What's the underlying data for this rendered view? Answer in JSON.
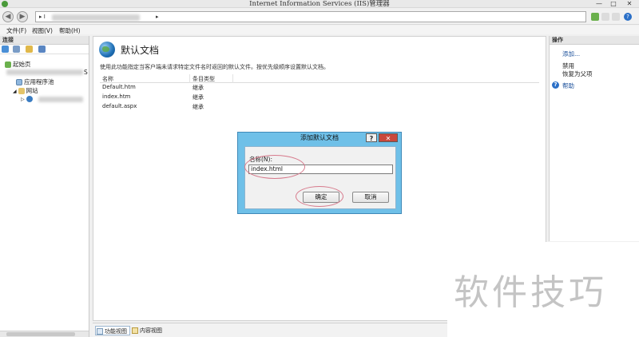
{
  "window": {
    "title": "Internet Information Services (IIS)管理器",
    "controls": [
      "—",
      "□",
      "✕"
    ]
  },
  "address_bar": {
    "back_icon": "back-arrow-icon",
    "forward_icon": "forward-arrow-icon",
    "path_first": "I",
    "toolbar_icons": [
      "stop-icon",
      "refresh-icon",
      "home-icon",
      "help-icon"
    ]
  },
  "menu": {
    "file": "文件(F)",
    "view": "视图(V)",
    "help": "帮助(H)"
  },
  "connections": {
    "header": "连接",
    "start_page": "起始页",
    "server_suffix": "S",
    "app_pools": "应用程序池",
    "sites": "网站"
  },
  "main": {
    "title": "默认文档",
    "description": "使用此功能指定当客户端未请求特定文件名时返回的默认文件。按优先级顺序设置默认文档。",
    "columns": [
      "名称",
      "条目类型"
    ],
    "rows": [
      {
        "name": "Default.htm",
        "type": "继承"
      },
      {
        "name": "index.htm",
        "type": "继承"
      },
      {
        "name": "default.aspx",
        "type": "继承"
      }
    ]
  },
  "bottom_tabs": {
    "features_view": "功能视图",
    "content_view": "内容视图"
  },
  "actions": {
    "header": "操作",
    "add": "添加...",
    "disable": "禁用",
    "revert": "恢复为父项",
    "help": "帮助"
  },
  "dialog": {
    "title": "添加默认文档",
    "help_button": "?",
    "close_button": "✕",
    "name_label": "名称(N):",
    "name_value": "index.html",
    "ok": "确定",
    "cancel": "取消"
  },
  "watermark": "软件技巧",
  "colors": {
    "dialog_frame": "#6fc0e8",
    "link": "#1a4f9a",
    "annotation": "#d77a8c"
  }
}
